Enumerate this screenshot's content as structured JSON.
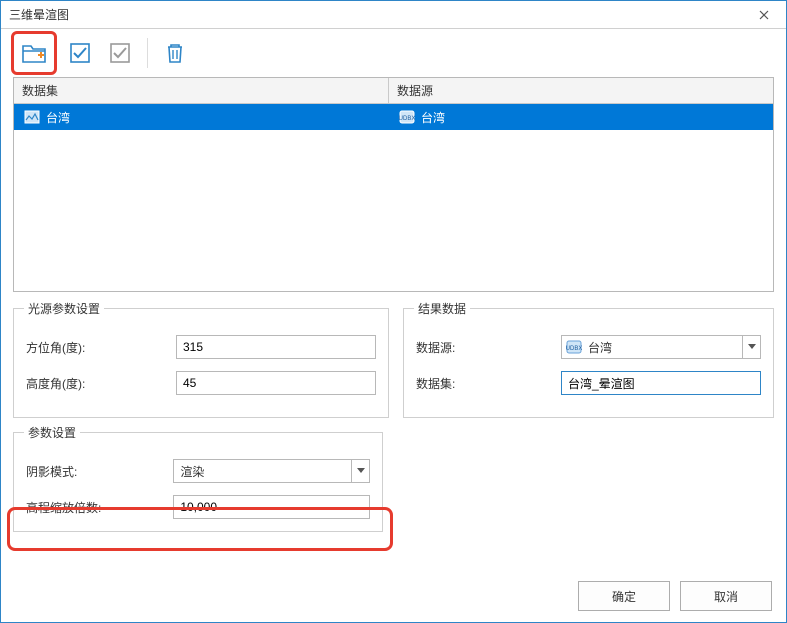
{
  "window": {
    "title": "三维晕渲图"
  },
  "toolbar": {
    "items": [
      "add-folder-icon",
      "check-blue-icon",
      "check-gray-icon",
      "trash-icon"
    ]
  },
  "table": {
    "headers": {
      "dataset": "数据集",
      "datasource": "数据源"
    },
    "rows": [
      {
        "dataset": "台湾",
        "datasource": "台湾"
      }
    ]
  },
  "groups": {
    "light": {
      "legend": "光源参数设置",
      "azimuth_label": "方位角(度):",
      "azimuth_value": "315",
      "altitude_label": "高度角(度):",
      "altitude_value": "45"
    },
    "result": {
      "legend": "结果数据",
      "datasource_label": "数据源:",
      "datasource_value": "台湾",
      "dataset_label": "数据集:",
      "dataset_value": "台湾_晕渲图"
    },
    "param": {
      "legend": "参数设置",
      "shadow_label": "阴影模式:",
      "shadow_value": "渲染",
      "zfactor_label": "高程缩放倍数:",
      "zfactor_value": "10,000"
    }
  },
  "footer": {
    "ok": "确定",
    "cancel": "取消"
  }
}
